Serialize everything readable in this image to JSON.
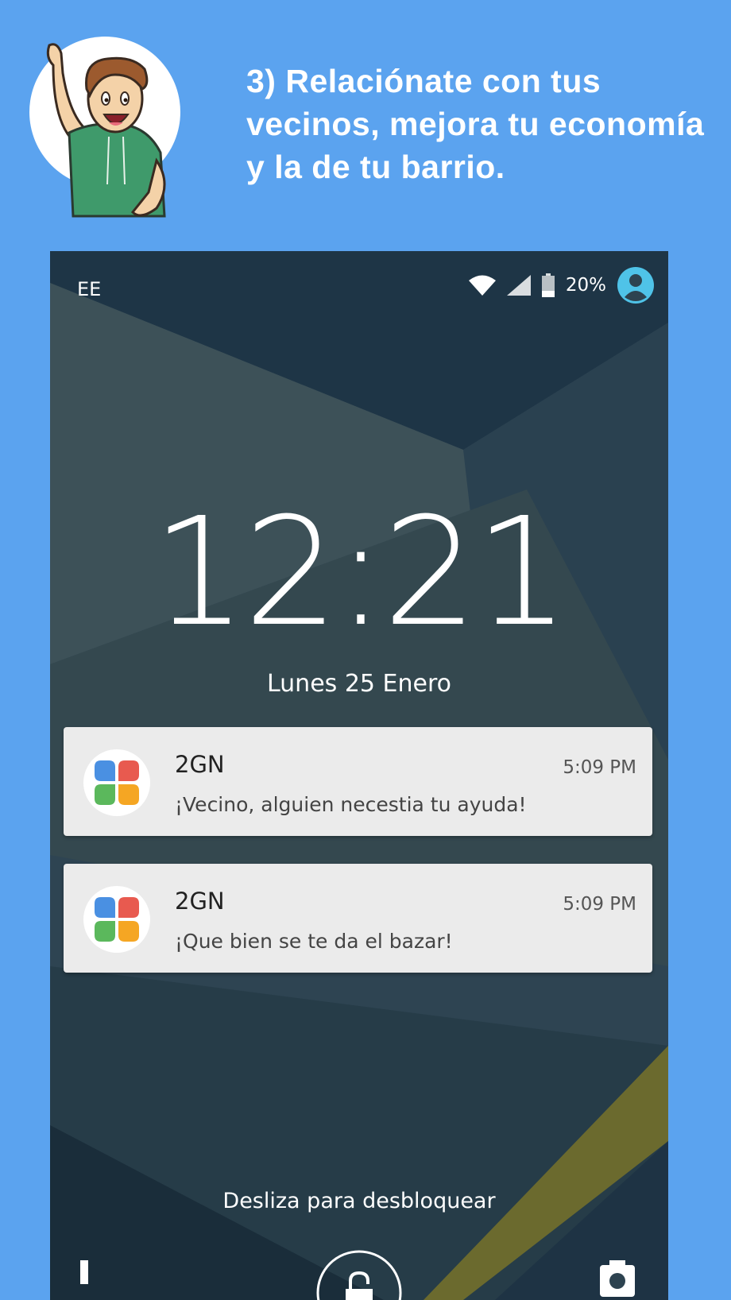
{
  "headline": "3) Relaciónate con tus vecinos, mejora tu economía y la de tu barrio.",
  "mascot_icon": "waving-man-illustration",
  "lockscreen": {
    "status_bar": {
      "carrier": "EE",
      "battery_percent": "20%",
      "icons": [
        "wifi-icon",
        "signal-icon",
        "battery-icon",
        "user-avatar-icon"
      ]
    },
    "clock": "12:21",
    "date": "Lunes 25 Enero",
    "notifications": [
      {
        "app": "2GN",
        "time": "5:09 PM",
        "message": "¡Vecino, alguien necestia tu ayuda!"
      },
      {
        "app": "2GN",
        "time": "5:09 PM",
        "message": "¡Que bien se te da el bazar!"
      }
    ],
    "unlock_hint": "Desliza para desbloquear",
    "bottom_icons": [
      "phone-icon",
      "lock-icon",
      "camera-icon"
    ]
  },
  "colors": {
    "page_background": "#5ba3ef",
    "lockscreen_background": "#2d4350",
    "notification_background": "#ebebeb",
    "avatar_accent": "#4fc3e8",
    "app_icon_blue": "#4a90e2",
    "app_icon_red": "#e85a4f",
    "app_icon_green": "#5bb85c",
    "app_icon_orange": "#f5a623"
  }
}
